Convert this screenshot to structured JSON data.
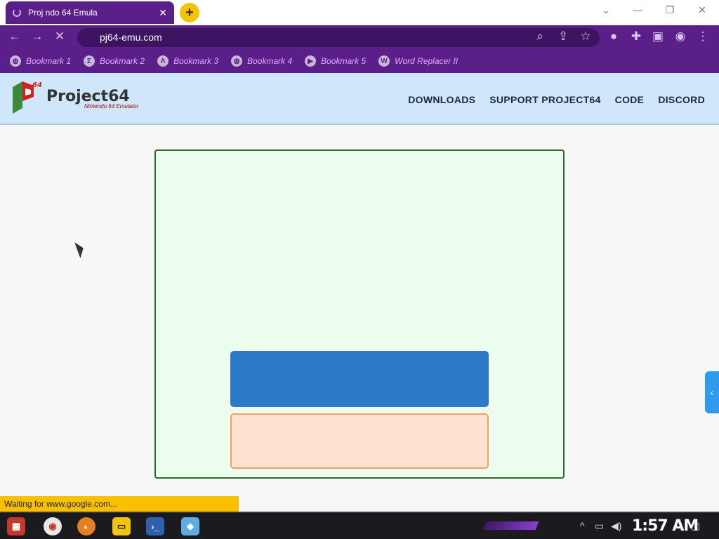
{
  "browser": {
    "tab_title": "Proj      ndo 64 Emula",
    "tab_close": "✕",
    "new_tab": "+",
    "address": "pj64-emu.com",
    "bookmarks": [
      {
        "label": "Bookmark 1",
        "icon": "globe-icon"
      },
      {
        "label": "Bookmark 2",
        "icon": "sigma-icon"
      },
      {
        "label": "Bookmark 3",
        "icon": "lambda-icon"
      },
      {
        "label": "Bookmark 4",
        "icon": "globe-icon"
      },
      {
        "label": "Bookmark 5",
        "icon": "movie-icon"
      },
      {
        "label": "Word Replacer II",
        "icon": "wr-icon"
      }
    ],
    "status": "Waiting for www.google.com..."
  },
  "site": {
    "logo_name": "Project64",
    "logo_tag": "Nintendo 64 Emulator",
    "logo_badge": "64",
    "nav": [
      "DOWNLOADS",
      "SUPPORT PROJECT64",
      "CODE",
      "DISCORD"
    ]
  },
  "side_tab": "‹",
  "taskbar": {
    "clock": "1:57 AM"
  },
  "colors": {
    "chrome_purple": "#5b1f8a",
    "header_bg": "#cfe6fb",
    "panel_bg": "#edfded",
    "panel_border": "#2a6e2a",
    "blue_box": "#2e78c8",
    "peach_box": "#ffe2d2",
    "status_bg": "#f8c000"
  }
}
